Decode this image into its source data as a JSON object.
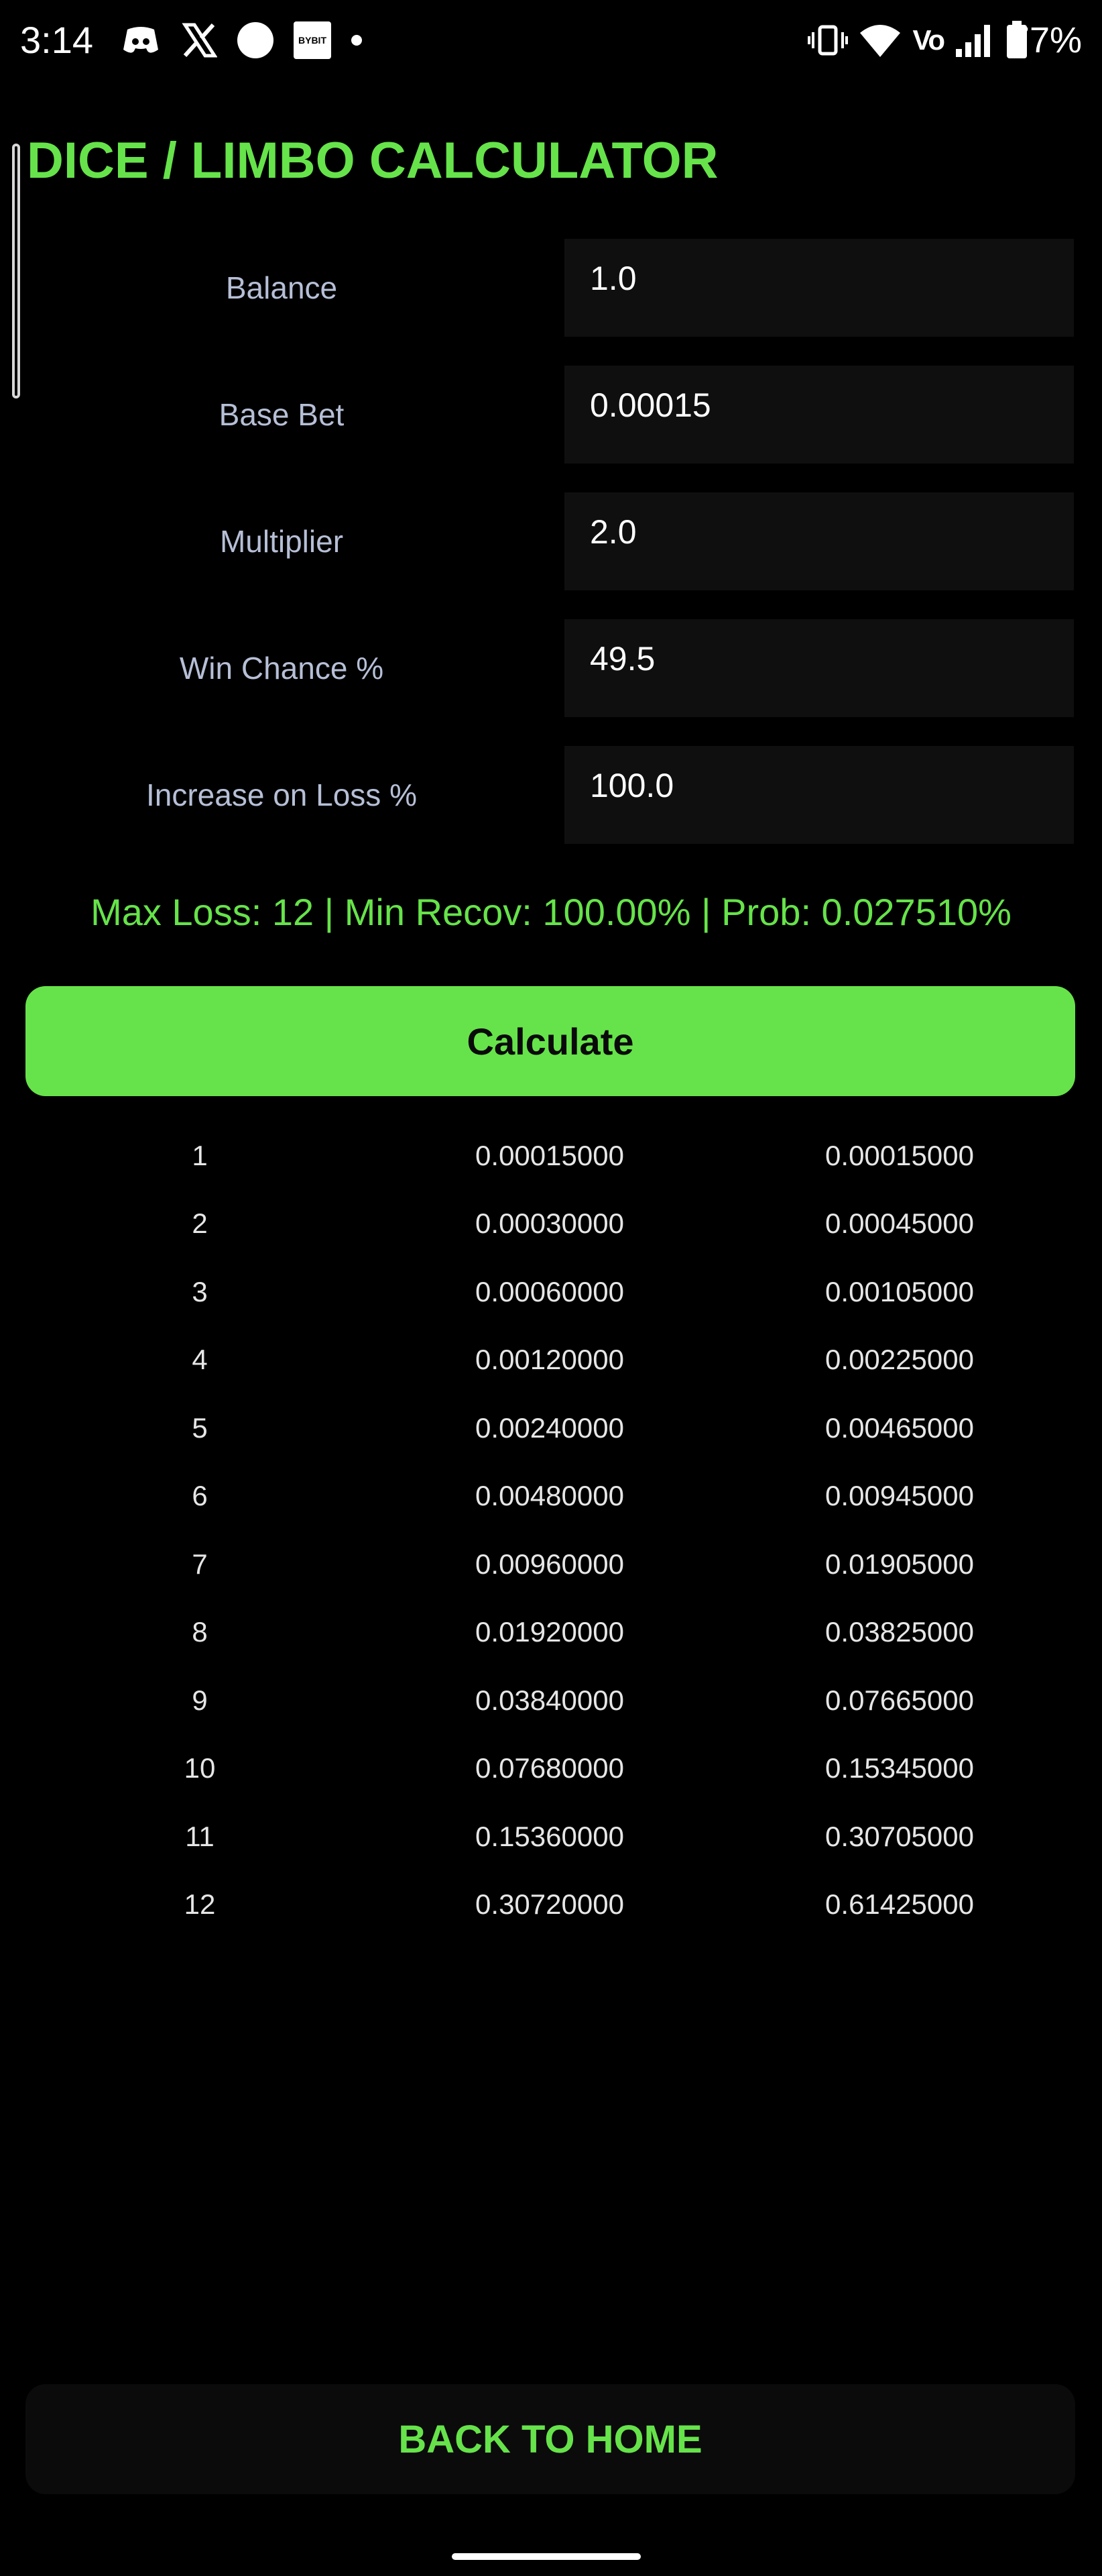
{
  "status_bar": {
    "time": "3:14",
    "battery_percent": "77%",
    "network_label": "Vo",
    "left_icons": [
      "discord-icon",
      "x-icon",
      "circle-icon",
      "bybit-icon",
      "dot-icon"
    ],
    "right_icons": [
      "vibrate-icon",
      "wifi-icon",
      "volte-icon",
      "signal-icon",
      "battery-icon"
    ],
    "bybit_label": "BYBIT"
  },
  "page": {
    "title": "DICE / LIMBO CALCULATOR"
  },
  "form": {
    "balance": {
      "label": "Balance",
      "value": "1.0"
    },
    "base_bet": {
      "label": "Base Bet",
      "value": "0.00015"
    },
    "multiplier": {
      "label": "Multiplier",
      "value": "2.0"
    },
    "win_chance": {
      "label": "Win Chance %",
      "value": "49.5"
    },
    "increase_on_loss": {
      "label": "Increase on Loss %",
      "value": "100.0"
    }
  },
  "summary": "Max Loss: 12 | Min Recov: 100.00% | Prob: 0.027510%",
  "buttons": {
    "calculate": "Calculate",
    "back_home": "BACK TO HOME"
  },
  "results": [
    [
      "1",
      "0.00015000",
      "0.00015000"
    ],
    [
      "2",
      "0.00030000",
      "0.00045000"
    ],
    [
      "3",
      "0.00060000",
      "0.00105000"
    ],
    [
      "4",
      "0.00120000",
      "0.00225000"
    ],
    [
      "5",
      "0.00240000",
      "0.00465000"
    ],
    [
      "6",
      "0.00480000",
      "0.00945000"
    ],
    [
      "7",
      "0.00960000",
      "0.01905000"
    ],
    [
      "8",
      "0.01920000",
      "0.03825000"
    ],
    [
      "9",
      "0.03840000",
      "0.07665000"
    ],
    [
      "10",
      "0.07680000",
      "0.15345000"
    ],
    [
      "11",
      "0.15360000",
      "0.30705000"
    ],
    [
      "12",
      "0.30720000",
      "0.61425000"
    ]
  ],
  "colors": {
    "accent": "#66e34a",
    "background": "#000000",
    "input_background": "#0f0f0f",
    "label": "#b6bfd6"
  }
}
